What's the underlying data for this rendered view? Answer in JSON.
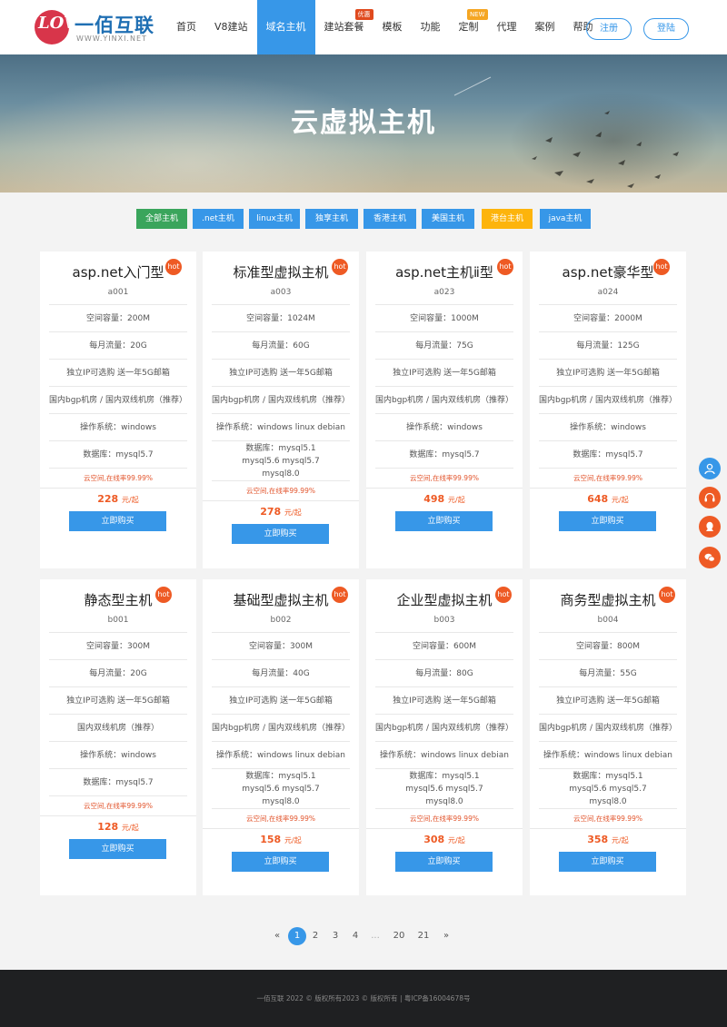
{
  "logo": {
    "mark": "LOV",
    "title": "一佰互联",
    "sub": "WWW.YINXI.NET"
  },
  "nav": [
    {
      "label": "首页"
    },
    {
      "label": "V8建站"
    },
    {
      "label": "域名主机",
      "active": true
    },
    {
      "label": "建站套餐",
      "badge": "优惠"
    },
    {
      "label": "模板"
    },
    {
      "label": "功能"
    },
    {
      "label": "定制",
      "badge": "NEW"
    },
    {
      "label": "代理"
    },
    {
      "label": "案例"
    },
    {
      "label": "帮助"
    }
  ],
  "auth": {
    "register": "注册",
    "login": "登陆"
  },
  "banner": {
    "title": "云虚拟主机"
  },
  "filters": [
    {
      "label": "全部主机",
      "color": "#3aa55c"
    },
    {
      "label": ".net主机",
      "color": "#3797e8"
    },
    {
      "label": "linux主机",
      "color": "#3797e8"
    },
    {
      "label": "独享主机",
      "color": "#3797e8"
    },
    {
      "label": "香港主机",
      "color": "#3797e8"
    },
    {
      "label": "美国主机",
      "color": "#3797e8"
    },
    {
      "label": "港台主机",
      "color": "#fdb40c"
    },
    {
      "label": "java主机",
      "color": "#3797e8"
    }
  ],
  "hot_label": "hot",
  "buy_label": "立即购买",
  "price_unit": "元/起",
  "products": [
    {
      "title": "asp.net入门型",
      "code": "a001",
      "rows": [
        "空间容量：200M",
        "每月流量：20G",
        "独立IP可选购 送一年5G邮箱",
        "国内bgp机房 / 国内双线机房（推荐）",
        "操作系统：windows",
        "数据库：mysql5.7"
      ],
      "note": "云空间,在线率99.99%",
      "price": "228"
    },
    {
      "title": "标准型虚拟主机",
      "code": "a003",
      "rows": [
        "空间容量：1024M",
        "每月流量：60G",
        "独立IP可选购 送一年5G邮箱",
        "国内bgp机房 / 国内双线机房（推荐）",
        "操作系统：windows linux debian",
        "数据库：mysql5.1 mysql5.6 mysql5.7 mysql8.0"
      ],
      "note": "云空间,在线率99.99%",
      "price": "278"
    },
    {
      "title": "asp.net主机ⅱ型",
      "code": "a023",
      "rows": [
        "空间容量：1000M",
        "每月流量：75G",
        "独立IP可选购 送一年5G邮箱",
        "国内bgp机房 / 国内双线机房（推荐）",
        "操作系统：windows",
        "数据库：mysql5.7"
      ],
      "note": "云空间,在线率99.99%",
      "price": "498"
    },
    {
      "title": "asp.net豪华型",
      "code": "a024",
      "rows": [
        "空间容量：2000M",
        "每月流量：125G",
        "独立IP可选购 送一年5G邮箱",
        "国内bgp机房 / 国内双线机房（推荐）",
        "操作系统：windows",
        "数据库：mysql5.7"
      ],
      "note": "云空间,在线率99.99%",
      "price": "648"
    },
    {
      "title": "静态型主机",
      "code": "b001",
      "rows": [
        "空间容量：300M",
        "每月流量：20G",
        "独立IP可选购 送一年5G邮箱",
        "国内双线机房（推荐）",
        "操作系统：windows",
        "数据库：mysql5.7"
      ],
      "note": "云空间,在线率99.99%",
      "price": "128"
    },
    {
      "title": "基础型虚拟主机",
      "code": "b002",
      "rows": [
        "空间容量：300M",
        "每月流量：40G",
        "独立IP可选购 送一年5G邮箱",
        "国内bgp机房 / 国内双线机房（推荐）",
        "操作系统：windows linux debian",
        "数据库：mysql5.1 mysql5.6 mysql5.7 mysql8.0"
      ],
      "note": "云空间,在线率99.99%",
      "price": "158"
    },
    {
      "title": "企业型虚拟主机",
      "code": "b003",
      "rows": [
        "空间容量：600M",
        "每月流量：80G",
        "独立IP可选购 送一年5G邮箱",
        "国内bgp机房 / 国内双线机房（推荐）",
        "操作系统：windows linux debian",
        "数据库：mysql5.1 mysql5.6 mysql5.7 mysql8.0"
      ],
      "note": "云空间,在线率99.99%",
      "price": "308"
    },
    {
      "title": "商务型虚拟主机",
      "code": "b004",
      "rows": [
        "空间容量：800M",
        "每月流量：55G",
        "独立IP可选购 送一年5G邮箱",
        "国内bgp机房 / 国内双线机房（推荐）",
        "操作系统：windows linux debian",
        "数据库：mysql5.1 mysql5.6 mysql5.7 mysql8.0"
      ],
      "note": "云空间,在线率99.99%",
      "price": "358"
    }
  ],
  "side_buttons": [
    {
      "icon": "user-icon",
      "color": "#3797e8"
    },
    {
      "icon": "headset-icon",
      "color": "#ee5a24"
    },
    {
      "icon": "qq-icon",
      "color": "#ee5a24"
    },
    {
      "icon": "wechat-icon",
      "color": "#ee5a24"
    }
  ],
  "pagination": {
    "prev": "«",
    "pages": [
      "1",
      "2",
      "3",
      "4",
      "...",
      "20",
      "21"
    ],
    "current": "1",
    "next": "»"
  },
  "footer": {
    "text": "一佰互联 2022 © 版权所有2023 © 版权所有 | 粤ICP备16004678号"
  }
}
